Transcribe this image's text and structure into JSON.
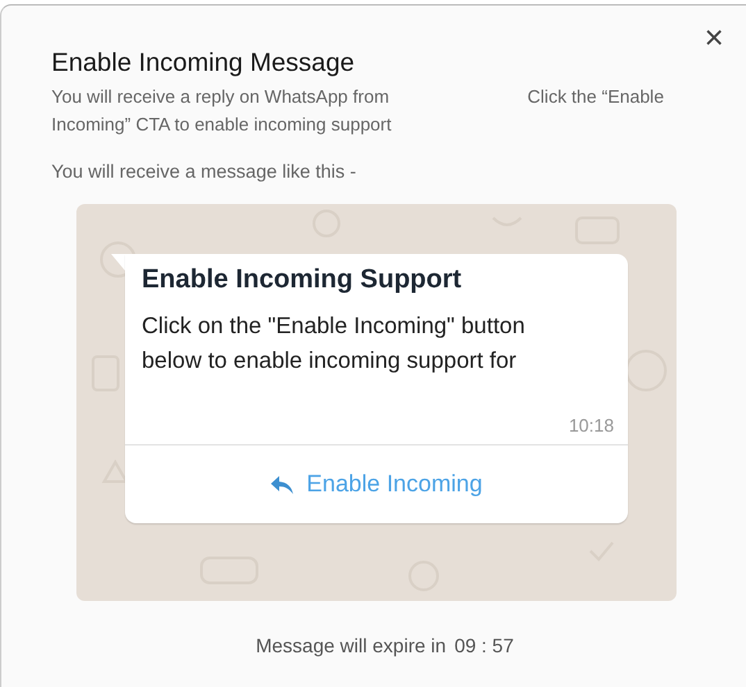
{
  "dialog": {
    "title": "Enable Incoming Message",
    "close": "×",
    "description": {
      "before": "You will receive a reply on WhatsApp from",
      "after": "Click the “Enable Incoming” CTA to enable incoming support"
    },
    "preview_intro": "You will receive a message like this -"
  },
  "preview": {
    "heading": "Enable Incoming Support",
    "body": "Click on the \"Enable Incoming\" button below to enable incoming support for",
    "time": "10:18",
    "action": "Enable Incoming"
  },
  "footer": {
    "label": "Message will expire in",
    "countdown": "09 : 57"
  }
}
